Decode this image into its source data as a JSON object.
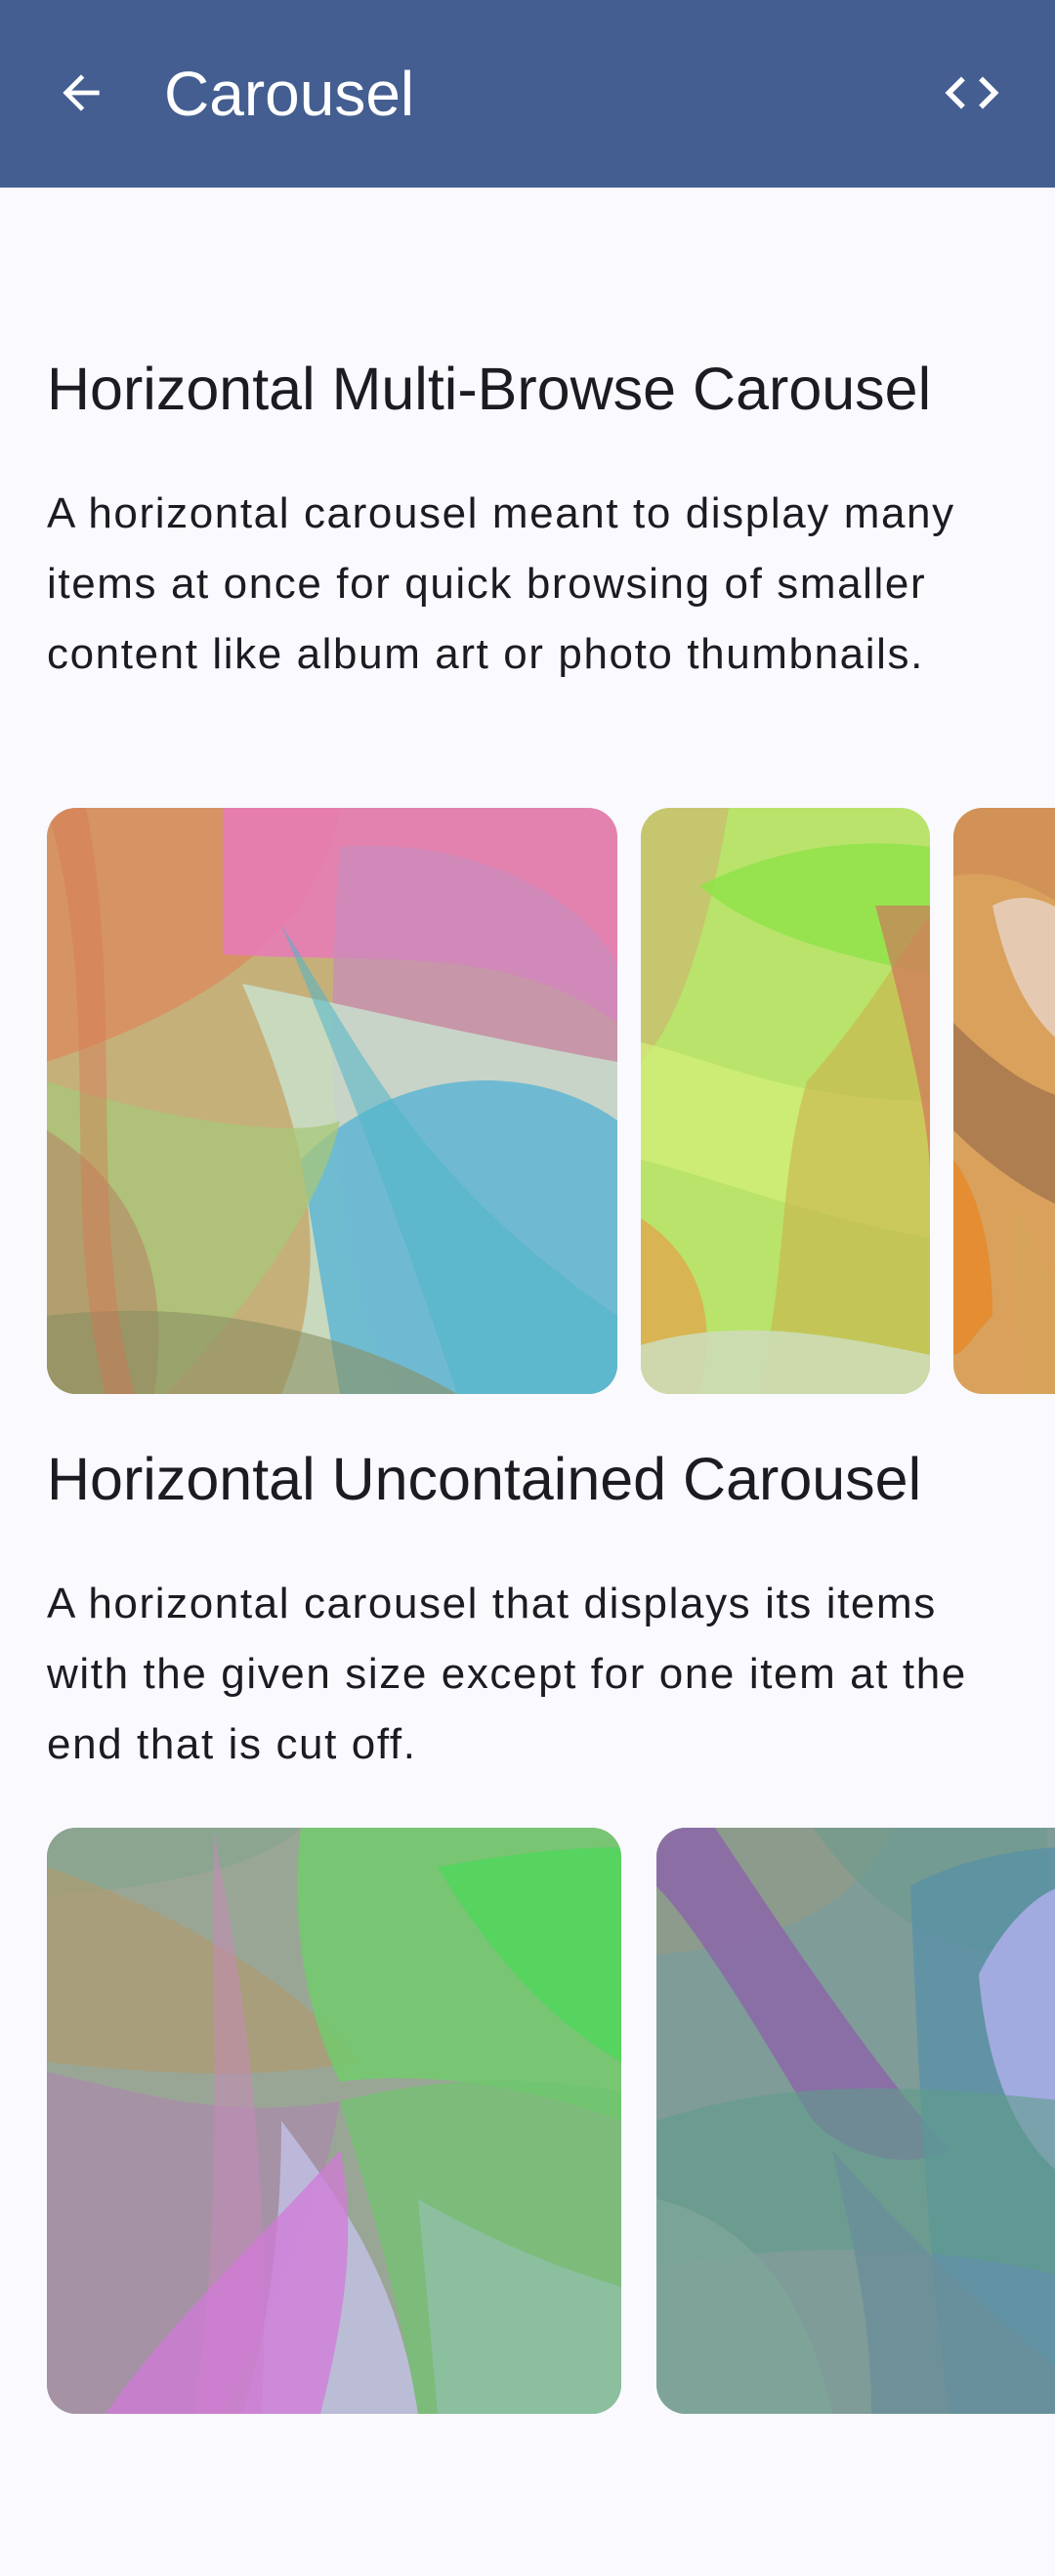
{
  "app_bar": {
    "title": "Carousel",
    "back_icon": "arrow-back-icon",
    "code_icon": "code-icon",
    "background_color": "#445e91"
  },
  "sections": [
    {
      "title": "Horizontal Multi-Browse Carousel",
      "description": "A horizontal carousel meant to display many items at once for quick browsing of smaller content like album art or photo thumbnails."
    },
    {
      "title": "Horizontal Uncontained Carousel",
      "description": "A horizontal carousel that displays its items with the given size except for one item at the end that is cut off."
    }
  ]
}
